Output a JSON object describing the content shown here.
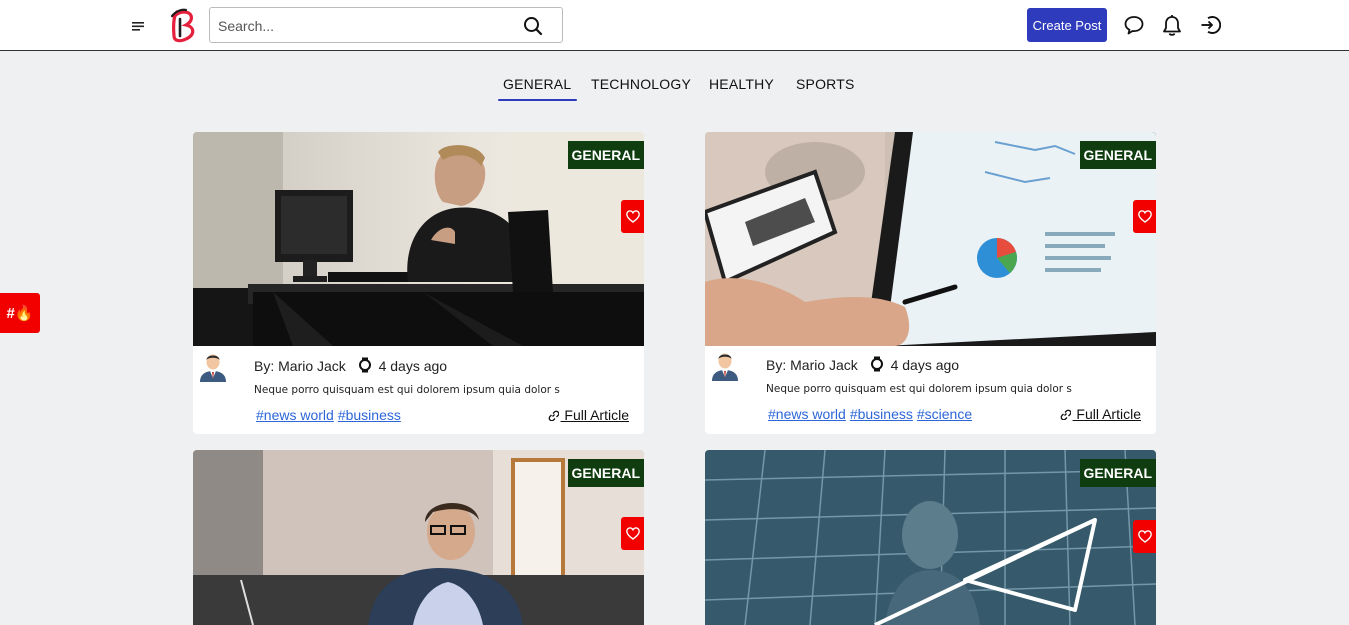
{
  "header": {
    "search_placeholder": "Search...",
    "create_post_label": "Create Post"
  },
  "tabs": [
    {
      "label": "GENERAL",
      "active": true
    },
    {
      "label": "TECHNOLOGY",
      "active": false
    },
    {
      "label": "HEALTHY",
      "active": false
    },
    {
      "label": "SPORTS",
      "active": false
    }
  ],
  "trending": {
    "label": "#🔥"
  },
  "posts": [
    {
      "category": "GENERAL",
      "author": "By: Mario Jack",
      "time": "4 days ago",
      "excerpt": "Neque porro quisquam est qui dolorem ipsum quia dolor s",
      "tags": [
        "#news world",
        "#business"
      ],
      "full_article_label": " Full Article"
    },
    {
      "category": "GENERAL",
      "author": "By: Mario Jack",
      "time": "4 days ago",
      "excerpt": "Neque porro quisquam est qui dolorem ipsum quia dolor s",
      "tags": [
        "#news world",
        "#business",
        "#science"
      ],
      "full_article_label": " Full Article"
    },
    {
      "category": "GENERAL"
    },
    {
      "category": "GENERAL"
    }
  ],
  "colors": {
    "accent": "#2f3bbd",
    "badge_bg": "#0f3d0f",
    "favorite_red": "#f20000",
    "tag_link": "#2c66d8",
    "page_bg": "#eef0f2"
  },
  "icons": [
    "menu-icon",
    "search-icon",
    "chat-bubble-icon",
    "bell-icon",
    "login-icon",
    "heart-icon",
    "watch-icon",
    "link-icon"
  ]
}
